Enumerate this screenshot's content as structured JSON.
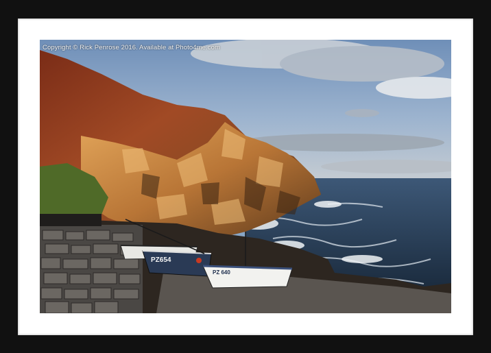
{
  "image": {
    "copyright_text": "Copyright © Rick Penrose 2016. Available at Photo4me.com",
    "boat_registrations": [
      "PZ654",
      "PZ 640"
    ]
  },
  "colors": {
    "frame": "#111111",
    "mat": "#ffffff",
    "sky": "#88a6c6",
    "sea": "#20354a",
    "cliff_rock": "#c88a45",
    "heather": "#8c3b1e"
  }
}
